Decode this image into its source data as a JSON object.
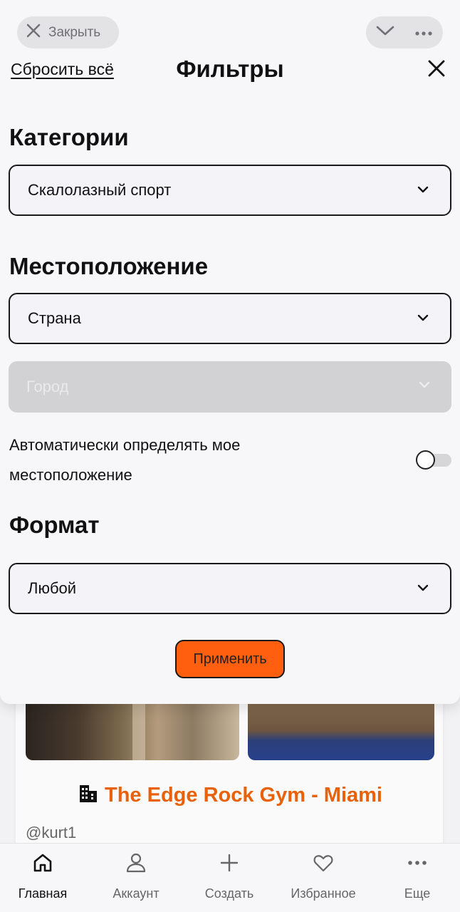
{
  "top_bar": {
    "close_label": "Закрыть"
  },
  "sheet": {
    "reset_label": "Сбросить всё",
    "title": "Фильтры"
  },
  "filters": {
    "category_heading": "Категории",
    "category_value": "Скалолазный спорт",
    "location_heading": "Местоположение",
    "country_value": "Страна",
    "city_value": "Город",
    "auto_location_label": "Автоматически определять мое местоположение",
    "auto_location_enabled": false,
    "format_heading": "Формат",
    "format_value": "Любой",
    "apply_label": "Применить"
  },
  "feed": {
    "gym_name": "The Edge Rock Gym - Miami",
    "user_handle": "@kurt1"
  },
  "bottom_nav": {
    "items": [
      {
        "label": "Главная",
        "icon": "home-icon",
        "active": true
      },
      {
        "label": "Аккаунт",
        "icon": "user-icon",
        "active": false
      },
      {
        "label": "Создать",
        "icon": "plus-icon",
        "active": false
      },
      {
        "label": "Избранное",
        "icon": "heart-icon",
        "active": false
      },
      {
        "label": "Еще",
        "icon": "more-icon",
        "active": false
      }
    ]
  },
  "colors": {
    "accent": "#ff5f0f",
    "gym_title": "#e8620c"
  }
}
